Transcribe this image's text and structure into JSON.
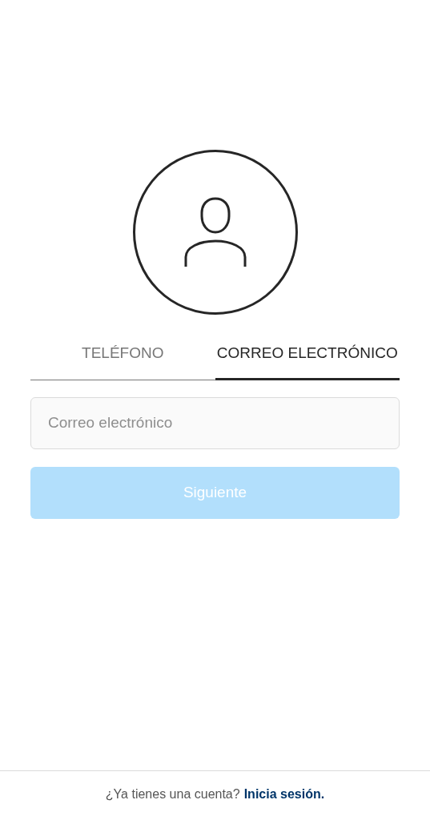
{
  "tabs": [
    {
      "label": "TELÉFONO",
      "selected": false
    },
    {
      "label": "CORREO ELECTRÓNICO",
      "selected": true
    }
  ],
  "email_field": {
    "placeholder": "Correo electrónico"
  },
  "next_button": {
    "label": "Siguiente",
    "disabled": true
  },
  "footer": {
    "text": "¿Ya tienes una cuenta?",
    "link": "Inicia sesión."
  }
}
